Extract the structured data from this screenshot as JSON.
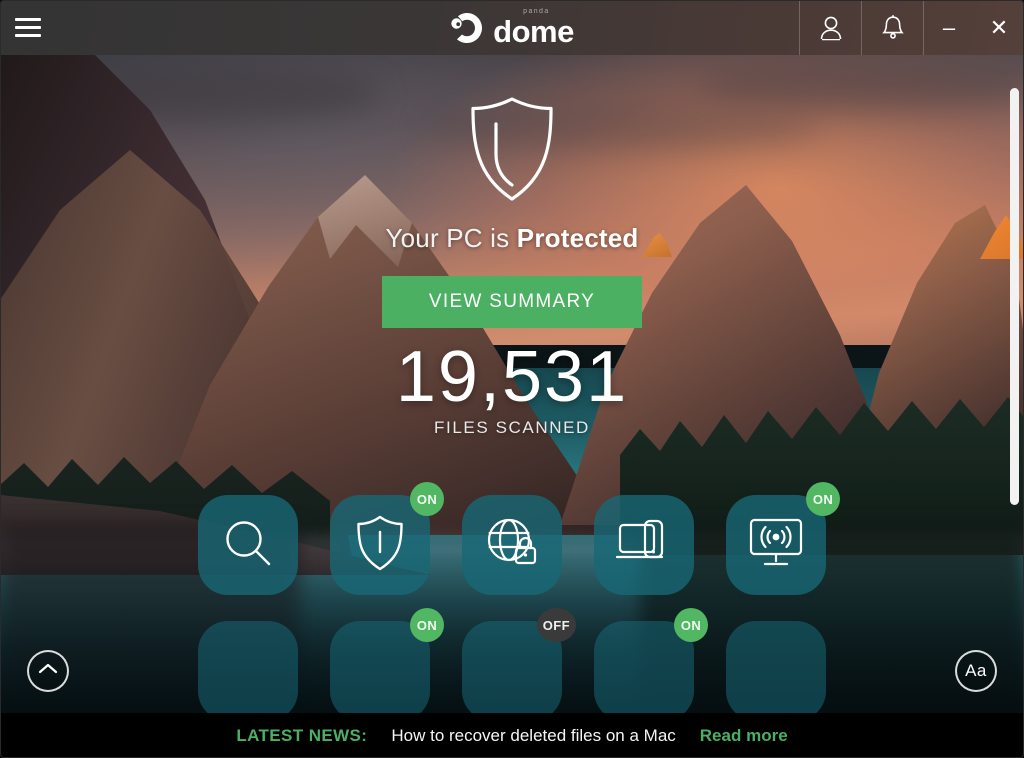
{
  "titlebar": {
    "menu_icon": "hamburger-menu-icon",
    "logo_brand": "panda",
    "logo_word": "dome",
    "account_icon": "user-account-icon",
    "notifications_icon": "bell-notification-icon",
    "minimize_label": "–",
    "close_label": "✕"
  },
  "status": {
    "shield_icon": "shield-protected-icon",
    "prefix": "Your PC is ",
    "state": "Protected",
    "summary_button": "VIEW SUMMARY",
    "scanned_count": "19,531",
    "scanned_label": "FILES SCANNED"
  },
  "tiles": {
    "row1": [
      {
        "name": "scan",
        "icon": "magnifier-scan-icon",
        "badge": null
      },
      {
        "name": "antivirus",
        "icon": "shield-antivirus-icon",
        "badge": "ON"
      },
      {
        "name": "vpn",
        "icon": "globe-lock-vpn-icon",
        "badge": null
      },
      {
        "name": "my-devices",
        "icon": "laptop-phone-devices-icon",
        "badge": null
      },
      {
        "name": "wifi-protection",
        "icon": "wifi-monitor-icon",
        "badge": "ON"
      }
    ],
    "row2": [
      {
        "name": "tile-6",
        "icon": "tile-icon",
        "badge": null
      },
      {
        "name": "tile-7",
        "icon": "tile-icon",
        "badge": "ON"
      },
      {
        "name": "tile-8",
        "icon": "tile-icon",
        "badge": "OFF"
      },
      {
        "name": "tile-9",
        "icon": "tile-icon",
        "badge": "ON"
      },
      {
        "name": "tile-10",
        "icon": "tile-icon",
        "badge": null
      }
    ]
  },
  "corners": {
    "collapse_icon": "chevron-up-icon",
    "font_size_label": "Aa"
  },
  "news": {
    "label": "LATEST NEWS:",
    "headline": "How to recover deleted files on a Mac",
    "read_more": "Read more"
  },
  "colors": {
    "accent_green": "#4cb063",
    "tile_teal": "#186876",
    "badge_on": "#52b763",
    "badge_off": "#3a3a3a",
    "titlebar_dark": "#3a3636"
  }
}
